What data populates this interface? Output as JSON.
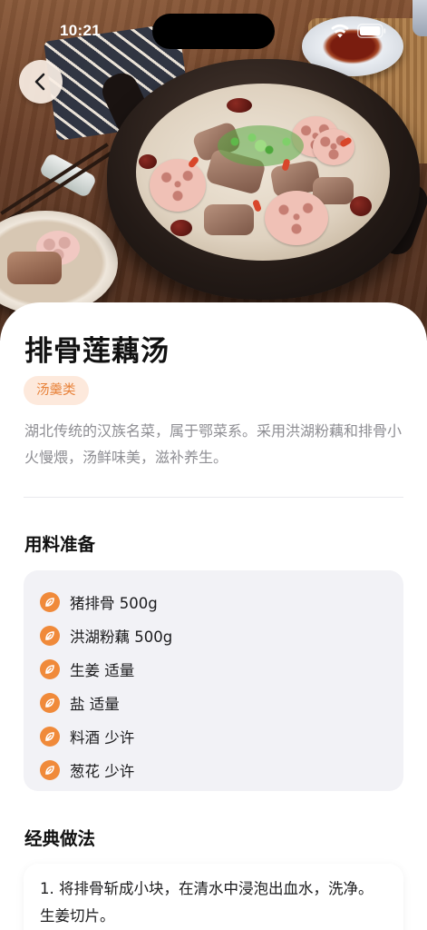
{
  "status_bar": {
    "time": "10:21"
  },
  "hero": {
    "icon": "food-photo"
  },
  "nav": {
    "back_icon": "chevron-left-icon"
  },
  "recipe": {
    "title": "排骨莲藕汤",
    "category_tag": "汤羹类",
    "description": "湖北传统的汉族名菜，属于鄂菜系。采用洪湖粉藕和排骨小火慢煨，汤鲜味美，滋补养生。"
  },
  "ingredients": {
    "section_title": "用料准备",
    "items": [
      {
        "text": "猪排骨 500g"
      },
      {
        "text": "洪湖粉藕 500g"
      },
      {
        "text": "生姜 适量"
      },
      {
        "text": "盐 适量"
      },
      {
        "text": "料酒 少许"
      },
      {
        "text": "葱花 少许"
      }
    ]
  },
  "method": {
    "section_title": "经典做法",
    "steps": [
      {
        "text": "1. 将排骨斩成小块，在清水中浸泡出血水，洗净。生姜切片。"
      }
    ]
  },
  "colors": {
    "accent": "#f08a3a",
    "tag_bg": "#fde9dc",
    "card_bg": "#f2f2f6",
    "muted_text": "#8e8e93"
  }
}
